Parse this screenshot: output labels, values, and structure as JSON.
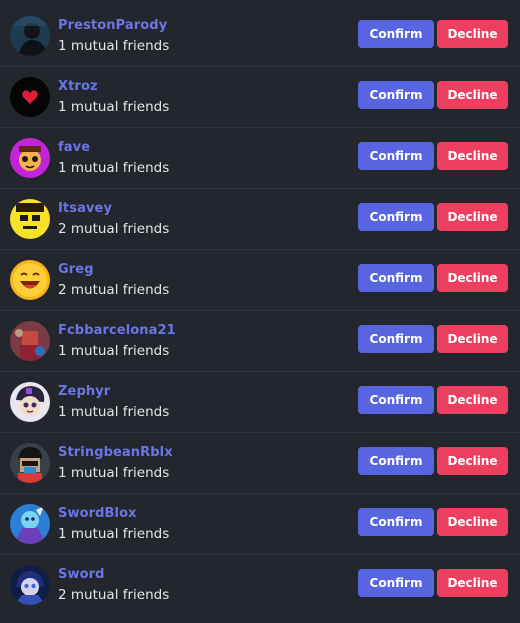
{
  "requests": [
    {
      "name": "PrestonParody",
      "mutual": "1 mutual friends",
      "confirm_label": "Confirm",
      "decline_label": "Decline"
    },
    {
      "name": "Xtroz",
      "mutual": "1 mutual friends",
      "confirm_label": "Confirm",
      "decline_label": "Decline"
    },
    {
      "name": "fave",
      "mutual": "1 mutual friends",
      "confirm_label": "Confirm",
      "decline_label": "Decline"
    },
    {
      "name": "Itsavey",
      "mutual": "2 mutual friends",
      "confirm_label": "Confirm",
      "decline_label": "Decline"
    },
    {
      "name": "Greg",
      "mutual": "2 mutual friends",
      "confirm_label": "Confirm",
      "decline_label": "Decline"
    },
    {
      "name": "Fcbbarcelona21",
      "mutual": "1 mutual friends",
      "confirm_label": "Confirm",
      "decline_label": "Decline"
    },
    {
      "name": "Zephyr",
      "mutual": "1 mutual friends",
      "confirm_label": "Confirm",
      "decline_label": "Decline"
    },
    {
      "name": "StringbeanRblx",
      "mutual": "1 mutual friends",
      "confirm_label": "Confirm",
      "decline_label": "Decline"
    },
    {
      "name": "SwordBlox",
      "mutual": "1 mutual friends",
      "confirm_label": "Confirm",
      "decline_label": "Decline"
    },
    {
      "name": "Sword",
      "mutual": "2 mutual friends",
      "confirm_label": "Confirm",
      "decline_label": "Decline"
    }
  ],
  "colors": {
    "background": "#23262d",
    "name": "#6a76e6",
    "confirm": "#5865e0",
    "decline": "#ee3f61"
  }
}
